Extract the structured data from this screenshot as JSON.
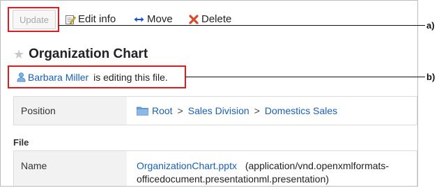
{
  "toolbar": {
    "update_label": "Update",
    "edit_label": "Edit info",
    "move_label": "Move",
    "delete_label": "Delete"
  },
  "page": {
    "title": "Organization Chart"
  },
  "editing": {
    "user": "Barbara Miller",
    "message": "is editing this file."
  },
  "details": {
    "position_label": "Position",
    "breadcrumb": [
      "Root",
      "Sales Division",
      "Domestics Sales"
    ],
    "separator": ">"
  },
  "file": {
    "section_title": "File",
    "name_label": "Name",
    "filename": "OrganizationChart.pptx",
    "mimetype": "(application/vnd.openxmlformats-officedocument.presentationml.presentation)"
  },
  "callouts": {
    "a": "a)",
    "b": "b)"
  },
  "colors": {
    "highlight": "#e01b1b",
    "link": "#1a5fb4",
    "label_bg": "#f2f2f2"
  }
}
